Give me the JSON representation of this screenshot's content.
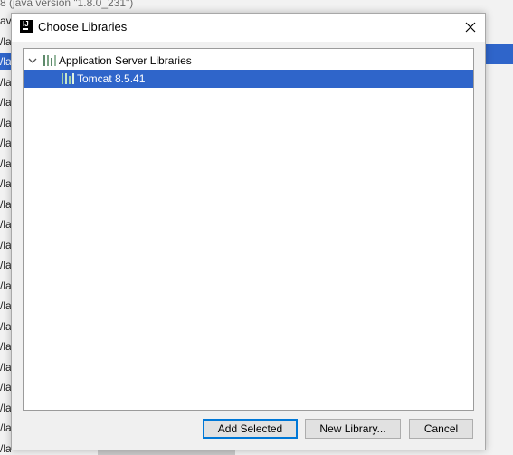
{
  "background": {
    "top_text": "8 (java version \"1.8.0_231\")",
    "left_rows": [
      "ava",
      "/lav",
      "/lav",
      "/lav",
      "/lav",
      "/lav",
      "/lav",
      "/lav",
      "/lav",
      "/lav",
      "/lav",
      "/lav",
      "/lav",
      "/lav",
      "/lav",
      "/lav",
      "/lav",
      "/lav",
      "/lav",
      "/lav",
      "/lav",
      "/lav"
    ],
    "selection_color": "#2f65ca"
  },
  "dialog": {
    "title": "Choose Libraries",
    "app_icon": "intellij-icon",
    "close_icon": "close-icon"
  },
  "tree": {
    "group": {
      "label": "Application Server Libraries",
      "expanded": true,
      "icon": "library-icon"
    },
    "items": [
      {
        "label": "Tomcat 8.5.41",
        "selected": true,
        "icon": "library-icon"
      }
    ],
    "selection_color": "#2f65ca"
  },
  "buttons": {
    "add_selected": "Add Selected",
    "new_library": "New Library...",
    "cancel": "Cancel"
  }
}
